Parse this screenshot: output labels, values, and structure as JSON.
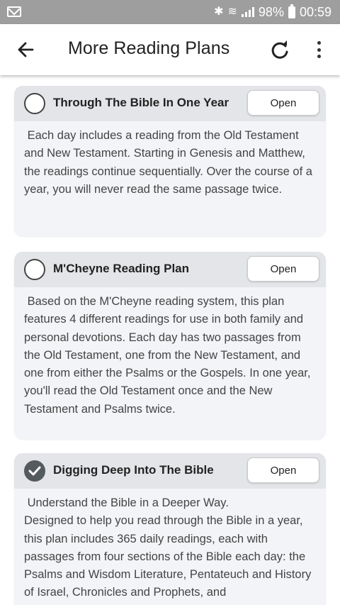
{
  "status_bar": {
    "notification_icon": "mail-icon",
    "battery": "98%",
    "time": "00:59"
  },
  "app_bar": {
    "title": "More Reading Plans",
    "back_icon": "arrow-left-icon",
    "refresh_icon": "refresh-icon",
    "more_icon": "more-vertical-icon"
  },
  "plans": [
    {
      "title": "Through The Bible In One Year",
      "button": "Open",
      "selected": false,
      "description": " Each day includes a reading from the Old Testament and New Testament. Starting in Genesis and Matthew, the readings continue sequentially. Over the course of a year, you will never read the same passage twice."
    },
    {
      "title": "M'Cheyne Reading Plan",
      "button": "Open",
      "selected": false,
      "description": " Based on the M'Cheyne reading system, this plan features 4 different readings for use in both family and personal devotions. Each day has two passages from the Old Testament, one from the New Testament, and one from either the Psalms or the Gospels. In one year, you'll read the Old Testament once and the New Testament and Psalms twice."
    },
    {
      "title": "Digging Deep Into The Bible",
      "button": "Open",
      "selected": true,
      "description": " Understand the Bible in a Deeper Way.\nDesigned to help you read through the Bible in a year, this plan includes 365 daily readings, each with passages from four sections of the Bible each day: the Psalms and Wisdom Literature, Pentateuch and History of Israel, Chronicles and Prophets, and"
    }
  ],
  "colors": {
    "status_bar": "#9e9e9e",
    "card_background": "#f2f4f7",
    "card_header": "#e3e5e8",
    "checked_radio": "#555a5f"
  }
}
